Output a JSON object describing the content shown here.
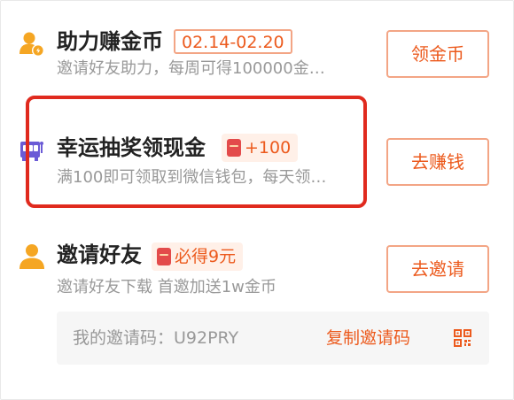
{
  "tasks": [
    {
      "title": "助力赚金币",
      "badge": "02.14-02.20",
      "desc": "邀请好友助力，每周可得100000金…",
      "button": "领金币",
      "icon": "user-coin-icon"
    },
    {
      "title": "幸运抽奖领现金",
      "badge": "+100",
      "desc": "满100即可领取到微信钱包，每天领…",
      "button": "去赚钱",
      "icon": "lottery-machine-icon"
    },
    {
      "title": "邀请好友",
      "badge": "必得9元",
      "desc": "邀请好友下载 首邀加送1w金币",
      "button": "去邀请",
      "icon": "user-icon"
    }
  ],
  "invite_code": {
    "text": "我的邀请码：U92PRY",
    "copy_label": "复制邀请码",
    "qr_icon": "qr-code-icon"
  },
  "colors": {
    "accent": "#ec5a1d",
    "icon_orange": "#f5a623",
    "icon_purple": "#6b5bd6",
    "highlight_red": "#e02a1e",
    "redpacket": "#e34b4b",
    "badge_bg": "#fff0e8"
  }
}
